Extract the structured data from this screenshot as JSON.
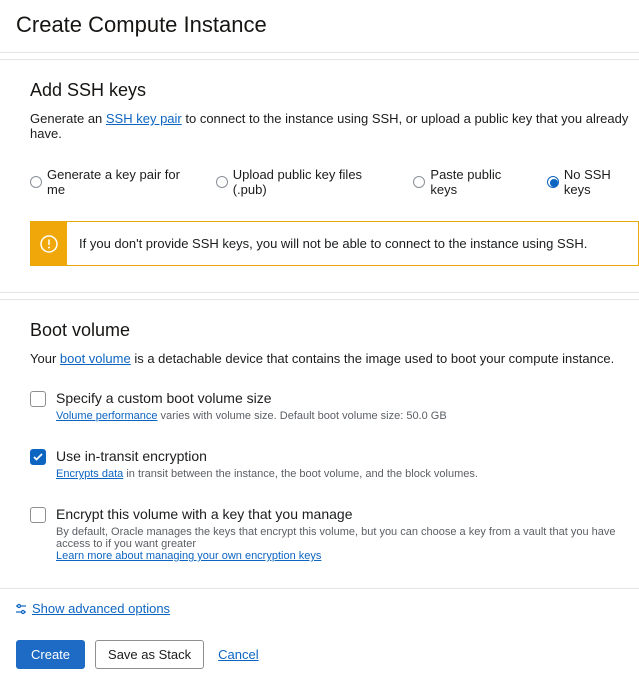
{
  "header": {
    "title": "Create Compute Instance"
  },
  "ssh": {
    "heading": "Add SSH keys",
    "desc_pre": "Generate an ",
    "desc_link": "SSH key pair",
    "desc_post": " to connect to the instance using SSH, or upload a public key that you already have.",
    "options": [
      {
        "label": "Generate a key pair for me",
        "selected": false
      },
      {
        "label": "Upload public key files (.pub)",
        "selected": false
      },
      {
        "label": "Paste public keys",
        "selected": false
      },
      {
        "label": "No SSH keys",
        "selected": true
      }
    ],
    "warning": "If you don't provide SSH keys, you will not be able to connect to the instance using SSH."
  },
  "boot": {
    "heading": "Boot volume",
    "desc_pre": "Your ",
    "desc_link": "boot volume",
    "desc_post": " is a detachable device that contains the image used to boot your compute instance.",
    "custom_size": {
      "label": "Specify a custom boot volume size",
      "help_link": "Volume performance",
      "help_text": " varies with volume size. Default boot volume size: 50.0 GB",
      "checked": false
    },
    "transit": {
      "label": "Use in-transit encryption",
      "help_link": "Encrypts data",
      "help_text": " in transit between the instance, the boot volume, and the block volumes.",
      "checked": true
    },
    "encrypt": {
      "label": "Encrypt this volume with a key that you manage",
      "help_text": "By default, Oracle manages the keys that encrypt this volume, but you can choose a key from a vault that you have access to if you want greater",
      "help_link": "Learn more about managing your own encryption keys",
      "checked": false
    }
  },
  "advanced": {
    "label": "Show advanced options"
  },
  "buttons": {
    "create": "Create",
    "save": "Save as Stack",
    "cancel": "Cancel"
  }
}
